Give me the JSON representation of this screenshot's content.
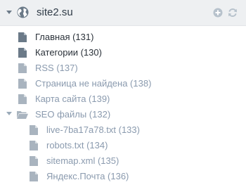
{
  "site": {
    "name": "site2.su",
    "icon": "globe-icon",
    "actions": {
      "add_icon": "plus-circle-icon",
      "refresh_icon": "refresh-icon"
    }
  },
  "colors": {
    "header_bg": "#eef0f2",
    "active_text": "#2a3139",
    "muted_text": "#8a9aae",
    "active_icon": "#6b7a88",
    "muted_icon": "#a9b4bf"
  },
  "tree": {
    "pages": [
      {
        "label": "Главная (131)",
        "state": "active"
      },
      {
        "label": "Категории (130)",
        "state": "active"
      },
      {
        "label": "RSS (137)",
        "state": "muted"
      },
      {
        "label": "Страница не найдена (138)",
        "state": "muted"
      },
      {
        "label": "Карта сайта (139)",
        "state": "muted"
      }
    ],
    "folder": {
      "label": "SEO файлы (132)",
      "expanded": true,
      "children": [
        {
          "label": "live-7ba17a78.txt (133)"
        },
        {
          "label": "robots.txt (134)"
        },
        {
          "label": "sitemap.xml (135)"
        },
        {
          "label": "Яндекс.Почта (136)"
        }
      ]
    }
  }
}
